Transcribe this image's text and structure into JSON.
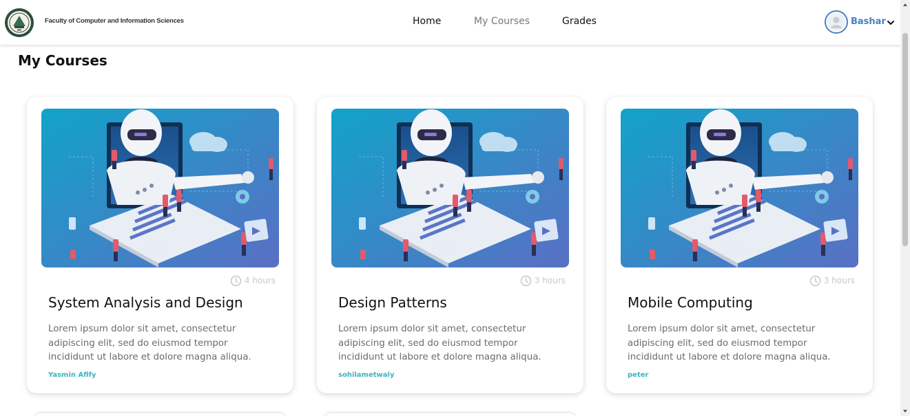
{
  "header": {
    "faculty_name": "Faculty of Computer and Information Sciences",
    "nav": {
      "home": "Home",
      "my_courses": "My Courses",
      "grades": "Grades"
    },
    "user": {
      "name": "Bashar"
    }
  },
  "main": {
    "title": "My Courses",
    "courses": [
      {
        "duration": "4 hours",
        "title": "System Analysis and Design",
        "description": "Lorem ipsum dolor sit amet, consectetur adipiscing elit, sed do eiusmod tempor incididunt ut labore et dolore magna aliqua.",
        "author": "Yasmin Afify"
      },
      {
        "duration": "3 hours",
        "title": "Design Patterns",
        "description": "Lorem ipsum dolor sit amet, consectetur adipiscing elit, sed do eiusmod tempor incididunt ut labore et dolore magna aliqua.",
        "author": "sohilametwaly"
      },
      {
        "duration": "3 hours",
        "title": "Mobile Computing",
        "description": "Lorem ipsum dolor sit amet, consectetur adipiscing elit, sed do eiusmod tempor incididunt ut labore et dolore magna aliqua.",
        "author": "peter"
      }
    ]
  },
  "colors": {
    "accent": "#4a7fc1",
    "author": "#3fb2bd",
    "image_gradient_start": "#11a3c9",
    "image_gradient_end": "#5a6fc4"
  },
  "icons": {
    "logo": "university-seal-icon",
    "avatar": "user-avatar-icon",
    "dropdown": "chevron-down-icon",
    "duration": "clock-icon"
  }
}
